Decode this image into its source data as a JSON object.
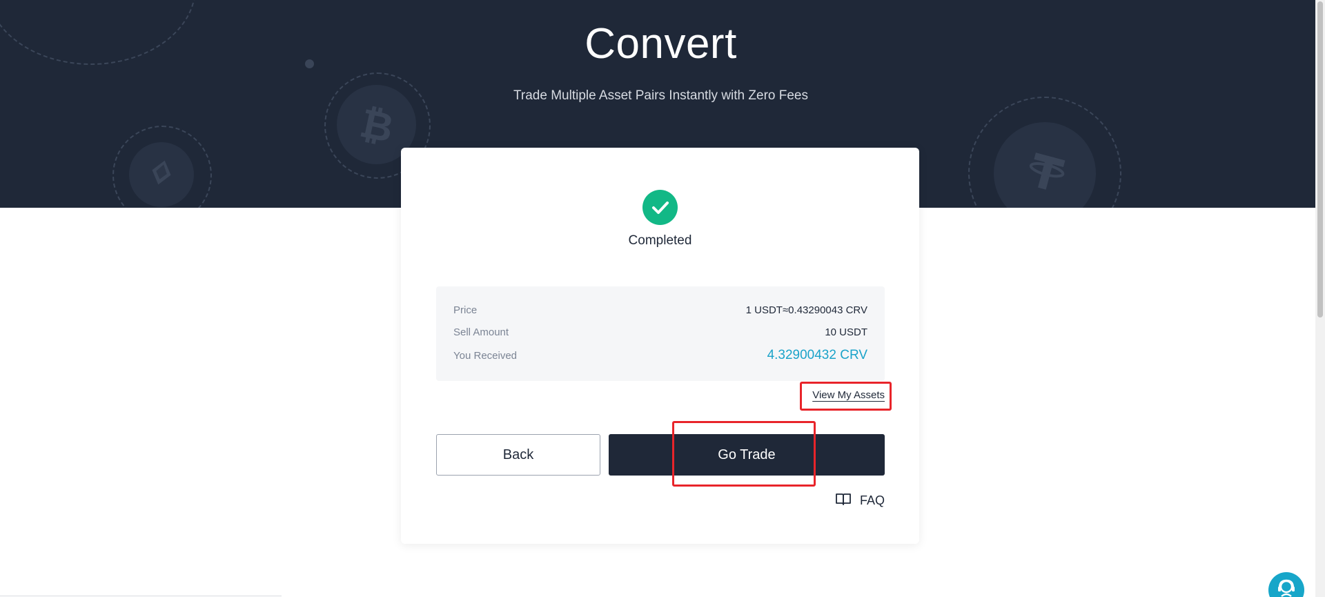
{
  "hero": {
    "title": "Convert",
    "subtitle": "Trade Multiple Asset Pairs Instantly with Zero Fees"
  },
  "result": {
    "status": "Completed",
    "summary": [
      {
        "label": "Price",
        "value": "1 USDT≈0.43290043 CRV"
      },
      {
        "label": "Sell Amount",
        "value": "10 USDT"
      },
      {
        "label": "You Received",
        "value": "4.32900432 CRV"
      }
    ],
    "view_assets_label": "View My Assets"
  },
  "actions": {
    "back_label": "Back",
    "trade_label": "Go Trade",
    "faq_label": "FAQ"
  },
  "colors": {
    "hero_bg": "#1f2838",
    "success": "#12b886",
    "highlight": "#1aa3c9",
    "annotation": "#e8242a"
  }
}
